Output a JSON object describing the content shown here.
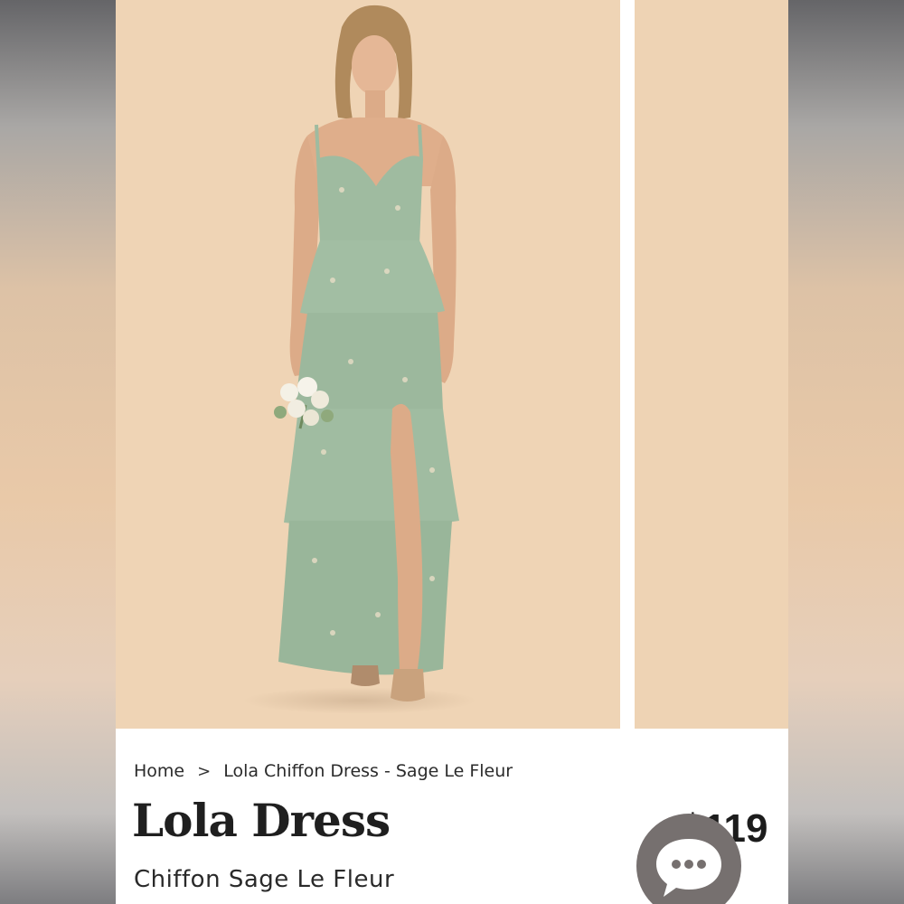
{
  "breadcrumb": {
    "home": "Home",
    "separator": ">",
    "current": "Lola Chiffon Dress - Sage Le Fleur"
  },
  "product": {
    "name": "Lola Dress",
    "variant": "Chiffon Sage Le Fleur",
    "price": "$119"
  },
  "images": {
    "main": "model-wearing-sage-tiered-maxi-dress",
    "next": "next-gallery-image-peek"
  },
  "chat": {
    "icon": "chat-bubble-icon"
  },
  "colors": {
    "dress": "#9fbba0",
    "backdrop": "#efd4b5",
    "chat_button": "#76706f"
  }
}
